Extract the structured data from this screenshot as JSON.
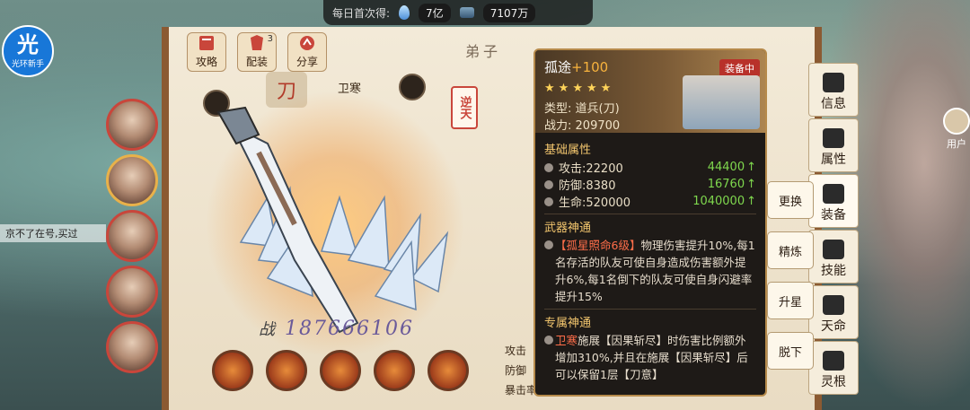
{
  "topbar": {
    "label": "每日首次得:",
    "jade": "7亿",
    "silver": "7107万"
  },
  "logo": {
    "main": "光",
    "sub": "光环新手"
  },
  "side_text": "京不了在号,买过",
  "tabs": [
    {
      "label": "攻略",
      "badge": ""
    },
    {
      "label": "配装",
      "badge": "3"
    },
    {
      "label": "分享",
      "badge": ""
    }
  ],
  "panel_title": "弟子",
  "weapon_type_char": "刀",
  "char_name": "卫寒",
  "nitian": "逆天",
  "master_tag": "掌门",
  "power": {
    "label": "战",
    "value": "187666106"
  },
  "stats_left": [
    "攻击",
    "防御",
    "暴击率"
  ],
  "vtabs": [
    "信息",
    "属性",
    "装备",
    "技能",
    "天命",
    "灵根"
  ],
  "user_center": "用户",
  "card": {
    "name": "孤途",
    "level": "+100",
    "equipped": "装备中",
    "stars": 5,
    "type_label": "类型:",
    "type_value": "道兵(刀)",
    "power_label": "战力:",
    "power_value": "209700",
    "base_title": "基础属性",
    "attrs": [
      {
        "name": "攻击:",
        "value": "22200",
        "bonus": "44400"
      },
      {
        "name": "防御:",
        "value": "8380",
        "bonus": "16760"
      },
      {
        "name": "生命:",
        "value": "520000",
        "bonus": "1040000"
      }
    ],
    "weapon_title": "武器神通",
    "weapon_skill_name": "【孤星照命6级】",
    "weapon_skill_desc": "物理伤害提升10%,每1名存活的队友可使自身造成伤害额外提升6%,每1名倒下的队友可使自身闪避率提升15%",
    "exclusive_title": "专属神通",
    "exclusive_hero": "卫寒",
    "exclusive_desc": "施展【因果斩尽】时伤害比例额外增加310%,并且在施展【因果斩尽】后可以保留1层【刀意】"
  },
  "actions": [
    "更换",
    "精炼",
    "升星",
    "脱下"
  ]
}
